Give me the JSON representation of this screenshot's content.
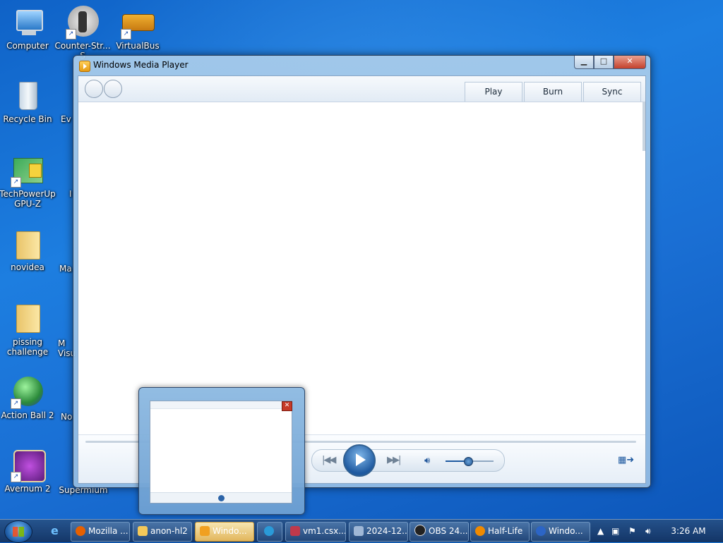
{
  "desktop": {
    "icons": [
      {
        "label": "Computer",
        "icon": "computer-icon"
      },
      {
        "label": "Counter-Str... S",
        "icon": "counter-strike-icon"
      },
      {
        "label": "VirtualBus",
        "icon": "virtualbus-icon"
      },
      {
        "label": "Recycle Bin",
        "icon": "recycle-bin-icon"
      },
      {
        "label": "TechPowerUp GPU-Z",
        "icon": "gpuz-icon"
      },
      {
        "label": "novidea",
        "icon": "folder-icon"
      },
      {
        "label": "pissing challenge",
        "icon": "folder-icon"
      },
      {
        "label": "Action Ball 2",
        "icon": "action-ball-icon"
      },
      {
        "label": "Avernum 2",
        "icon": "avernum-icon"
      },
      {
        "label": "Supermium",
        "icon": "supermium-icon"
      }
    ],
    "partial_labels": [
      "Ev",
      "I",
      "Ma",
      "M Visu",
      "No"
    ]
  },
  "window": {
    "title": "Windows Media Player",
    "buttons": {
      "minimize": "▁",
      "maximize": "□",
      "close": "✕"
    },
    "tabs": [
      "Play",
      "Burn",
      "Sync"
    ],
    "volume_level": 0.47
  },
  "taskbar": {
    "items": [
      {
        "label": "Mozilla ...",
        "icon": "firefox-icon",
        "color": "#e66000"
      },
      {
        "label": "anon-hl2",
        "icon": "folder-icon",
        "color": "#f3c85a"
      },
      {
        "label": "Windo...",
        "icon": "media-player-icon",
        "color": "#f0a020"
      },
      {
        "label": "",
        "icon": "app-icon",
        "color": "#2a9ad8"
      },
      {
        "label": "vm1.csx...",
        "icon": "vm-icon",
        "color": "#c0394b"
      },
      {
        "label": "2024-12...",
        "icon": "notepad-icon",
        "color": "#9fb7d6"
      },
      {
        "label": "OBS 24....",
        "icon": "obs-icon",
        "color": "#222222"
      },
      {
        "label": "Half-Life",
        "icon": "half-life-icon",
        "color": "#f08a00"
      },
      {
        "label": "Windo...",
        "icon": "help-icon",
        "color": "#2c65c6"
      }
    ],
    "clock": "3:26 AM"
  }
}
